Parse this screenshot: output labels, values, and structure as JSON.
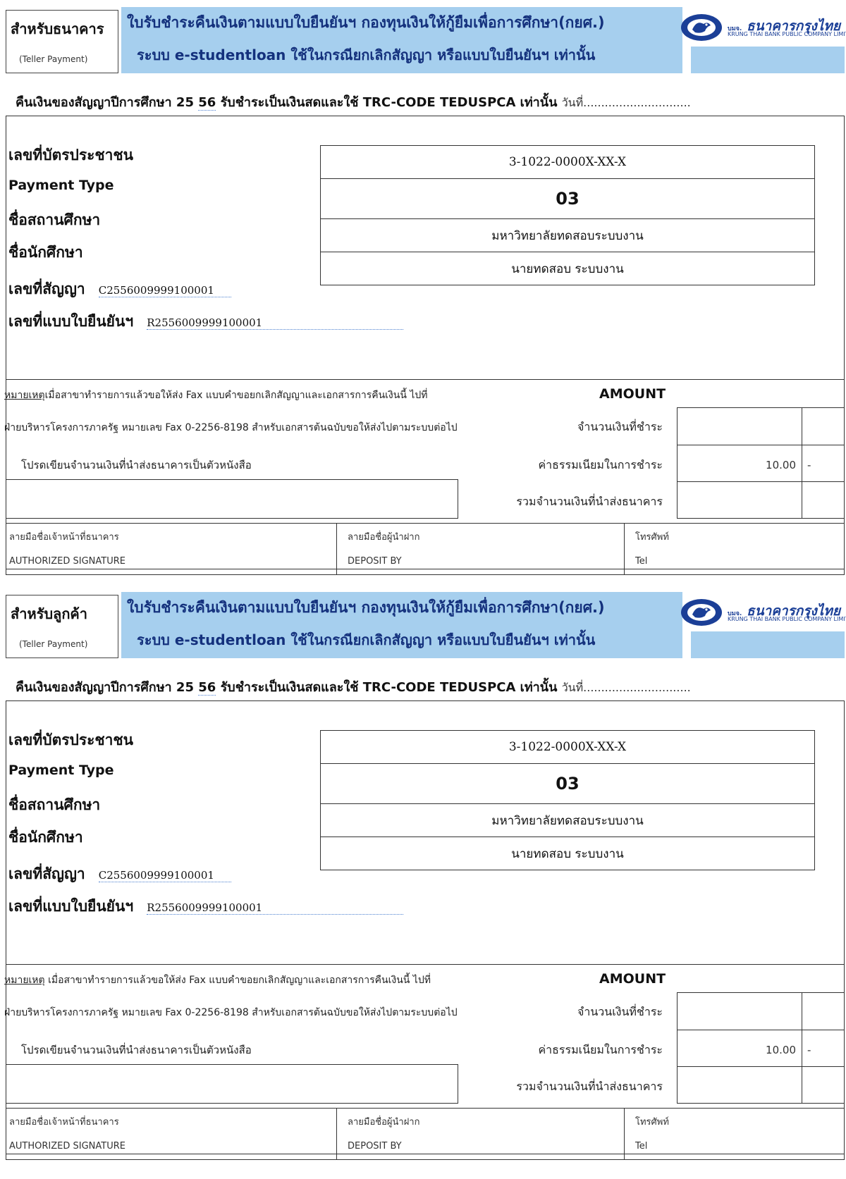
{
  "bank": {
    "logo_text": "ธนาคารกรุงไทย",
    "logo_prefix": "บมจ.",
    "logo_small": "KRUNG THAI BANK PUBLIC COMPANY LIMITED"
  },
  "colors": {
    "header_band": "#a6cfee",
    "title_text": "#14317d",
    "logo_blue": "#1b3f97"
  },
  "slips": [
    {
      "copy_label": "สำหรับธนาคาร",
      "copy_sub": "(Teller Payment)",
      "title_line1": "ใบรับชำระคืนเงินตามแบบใบยืนยันฯ กองทุนเงินให้กู้ยืมเพื่อการศึกษา(กยศ.)",
      "title_line2": "ระบบ e-studentloan  ใช้ในกรณียกเลิกสัญญา หรือแบบใบยืนยันฯ เท่านั้น",
      "year_prefix": "คืนเงินของสัญญาปีการศึกษา 25",
      "year_suffix": "56",
      "year_rest": " รับชำระเป็นเงินสดและใช้ TRC-CODE TEDUSPCA เท่านั้น",
      "date_label": "วันที่",
      "date_dots": "..............................",
      "labels": {
        "citizen_id": "เลขที่บัตรประชาชน",
        "payment_type": "Payment Type",
        "institution": "ชื่อสถานศึกษา",
        "student": "ชื่อนักศึกษา",
        "contract_no": "เลขที่สัญญา",
        "confirm_no": "เลขที่แบบใบยืนยันฯ"
      },
      "values": {
        "citizen_id": "3-1022-0000X-XX-X",
        "payment_type": "03",
        "institution": "มหาวิทยาลัยทดสอบระบบงาน",
        "student": "นายทดสอบ ระบบงาน",
        "contract_no": "C2556009999100001",
        "confirm_no": "R2556009999100001"
      },
      "note_label": "หมายเหตุ",
      "note_line1": "เมื่อสาขาทำรายการแล้วขอให้ส่ง Fax แบบคำขอยกเลิกสัญญาและเอกสารการคืนเงินนี้ ไปที่",
      "note_line2": "ฝ่ายบริหารโครงการภาครัฐ หมายเลข  Fax  0-2256-8198 สำหรับเอกสารต้นฉบับขอให้ส่งไปตามระบบต่อไป",
      "words_prompt": "โปรดเขียนจำนวนเงินที่นำส่งธนาคารเป็นตัวหนังสือ",
      "amount_header": "AMOUNT",
      "amount_rows": [
        {
          "label": "จำนวนเงินที่ชำระ",
          "value": "",
          "dash": ""
        },
        {
          "label": "ค่าธรรมเนียมในการชำระ",
          "value": "10.00",
          "dash": "-"
        },
        {
          "label": "รวมจำนวนเงินที่นำส่งธนาคาร",
          "value": "",
          "dash": ""
        }
      ],
      "signatures": [
        {
          "th": "ลายมือชื่อเจ้าหน้าที่ธนาคาร",
          "en": "AUTHORIZED SIGNATURE"
        },
        {
          "th": "ลายมือชื่อผู้นำฝาก",
          "en": "DEPOSIT BY"
        },
        {
          "th": "โทรศัพท์",
          "en": "Tel"
        }
      ]
    },
    {
      "copy_label": "สำหรับลูกค้า",
      "copy_sub": "(Teller Payment)",
      "title_line1": "ใบรับชำระคืนเงินตามแบบใบยืนยันฯ กองทุนเงินให้กู้ยืมเพื่อการศึกษา(กยศ.)",
      "title_line2": "ระบบ e-studentloan  ใช้ในกรณียกเลิกสัญญา หรือแบบใบยืนยันฯ เท่านั้น",
      "year_prefix": "คืนเงินของสัญญาปีการศึกษา 25",
      "year_suffix": "56",
      "year_rest": " รับชำระเป็นเงินสดและใช้ TRC-CODE TEDUSPCA เท่านั้น",
      "date_label": "วันที่",
      "date_dots": "..............................",
      "labels": {
        "citizen_id": "เลขที่บัตรประชาชน",
        "payment_type": "Payment Type",
        "institution": "ชื่อสถานศึกษา",
        "student": "ชื่อนักศึกษา",
        "contract_no": "เลขที่สัญญา",
        "confirm_no": "เลขที่แบบใบยืนยันฯ"
      },
      "values": {
        "citizen_id": "3-1022-0000X-XX-X",
        "payment_type": "03",
        "institution": "มหาวิทยาลัยทดสอบระบบงาน",
        "student": "นายทดสอบ ระบบงาน",
        "contract_no": "C2556009999100001",
        "confirm_no": "R2556009999100001"
      },
      "note_label": "หมายเหตุ",
      "note_line1": " เมื่อสาขาทำรายการแล้วขอให้ส่ง Fax แบบคำขอยกเลิกสัญญาและเอกสารการคืนเงินนี้ ไปที่",
      "note_line2": "ฝ่ายบริหารโครงการภาครัฐ หมายเลข  Fax  0-2256-8198 สำหรับเอกสารต้นฉบับขอให้ส่งไปตามระบบต่อไป",
      "words_prompt": "โปรดเขียนจำนวนเงินที่นำส่งธนาคารเป็นตัวหนังสือ",
      "amount_header": "AMOUNT",
      "amount_rows": [
        {
          "label": "จำนวนเงินที่ชำระ",
          "value": "",
          "dash": ""
        },
        {
          "label": "ค่าธรรมเนียมในการชำระ",
          "value": "10.00",
          "dash": "-"
        },
        {
          "label": "รวมจำนวนเงินที่นำส่งธนาคาร",
          "value": "",
          "dash": ""
        }
      ],
      "signatures": [
        {
          "th": "ลายมือชื่อเจ้าหน้าที่ธนาคาร",
          "en": "AUTHORIZED SIGNATURE"
        },
        {
          "th": "ลายมือชื่อผู้นำฝาก",
          "en": "DEPOSIT BY"
        },
        {
          "th": "โทรศัพท์",
          "en": "Tel"
        }
      ]
    }
  ]
}
